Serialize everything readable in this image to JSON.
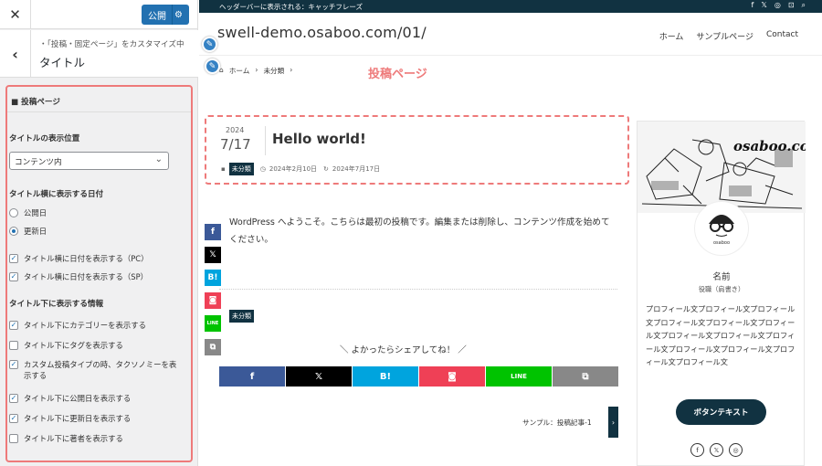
{
  "sidebar": {
    "close_label": "✕",
    "publish_label": "公開",
    "back_label": "‹",
    "crumb_sub": "・「投稿・固定ページ」をカスタマイズ中",
    "crumb_title": "タイトル",
    "panel_title": "■ 投稿ページ",
    "title_position": {
      "heading": "タイトルの表示位置",
      "selected": "コンテンツ内"
    },
    "date": {
      "heading": "タイトル横に表示する日付",
      "options": [
        {
          "label": "公開日",
          "checked": false
        },
        {
          "label": "更新日",
          "checked": true
        }
      ]
    },
    "date_checks": [
      {
        "label": "タイトル横に日付を表示する（PC）",
        "checked": true
      },
      {
        "label": "タイトル横に日付を表示する（SP）",
        "checked": true
      }
    ],
    "info": {
      "heading": "タイトル下に表示する情報",
      "items": [
        {
          "label": "タイトル下にカテゴリーを表示する",
          "checked": true
        },
        {
          "label": "タイトル下にタグを表示する",
          "checked": false
        },
        {
          "label": "カスタム投稿タイプの時、タクソノミーを表",
          "label2": "示する",
          "checked": true
        },
        {
          "label": "タイトル下に公開日を表示する",
          "checked": true
        },
        {
          "label": "タイトル下に更新日を表示する",
          "checked": true
        },
        {
          "label": "タイトル下に著者を表示する",
          "checked": false
        }
      ]
    }
  },
  "preview": {
    "topbar_text": "ヘッダーバーに表示される：キャッチフレーズ",
    "topbar_icons": [
      "f",
      "𝕏",
      "◎",
      "⊡",
      "⌕"
    ],
    "site_title": "swell-demo.osaboo.com/01/",
    "nav": [
      "ホーム",
      "サンプルページ",
      "Contact"
    ],
    "breadcrumb": [
      "ホーム",
      "›",
      "未分類",
      "›"
    ],
    "annotation": "投稿ページ",
    "post": {
      "year": "2024",
      "month_day": "7/17",
      "title": "Hello world!",
      "category": "未分類",
      "published": "2024年2月10日",
      "updated": "2024年7月17日",
      "content": "WordPress へようこそ。こちらは最初の投稿です。編集または削除し、コンテンツ作成を始めてください。"
    },
    "share_heading": "＼ よかったらシェアしてね！ ／",
    "share_buttons": [
      {
        "name": "facebook",
        "glyph": "f",
        "color": "#3b5998"
      },
      {
        "name": "x",
        "glyph": "𝕏",
        "color": "#000000"
      },
      {
        "name": "hatena",
        "glyph": "B!",
        "color": "#00a4de"
      },
      {
        "name": "pocket",
        "glyph": "◙",
        "color": "#ef4056"
      },
      {
        "name": "line",
        "glyph": "LINE",
        "color": "#00c300"
      },
      {
        "name": "copy",
        "glyph": "⧉",
        "color": "#888888"
      }
    ],
    "next_link": "サンプル：投稿記事-1",
    "next_arrow": "›",
    "profile": {
      "pic_text": "osaboo.com",
      "avatar_text": "osaboo",
      "name": "名前",
      "role": "役職（肩書き）",
      "bio": "プロフィール文プロフィール文プロフィール文プロフィール文プロフィール文プロフィール文プロフィール文プロフィール文プロフィール文プロフィール文プロフィール文プロフィール文プロフィール文",
      "button": "ボタンテキスト",
      "social": [
        "f",
        "𝕏",
        "◎"
      ]
    }
  }
}
